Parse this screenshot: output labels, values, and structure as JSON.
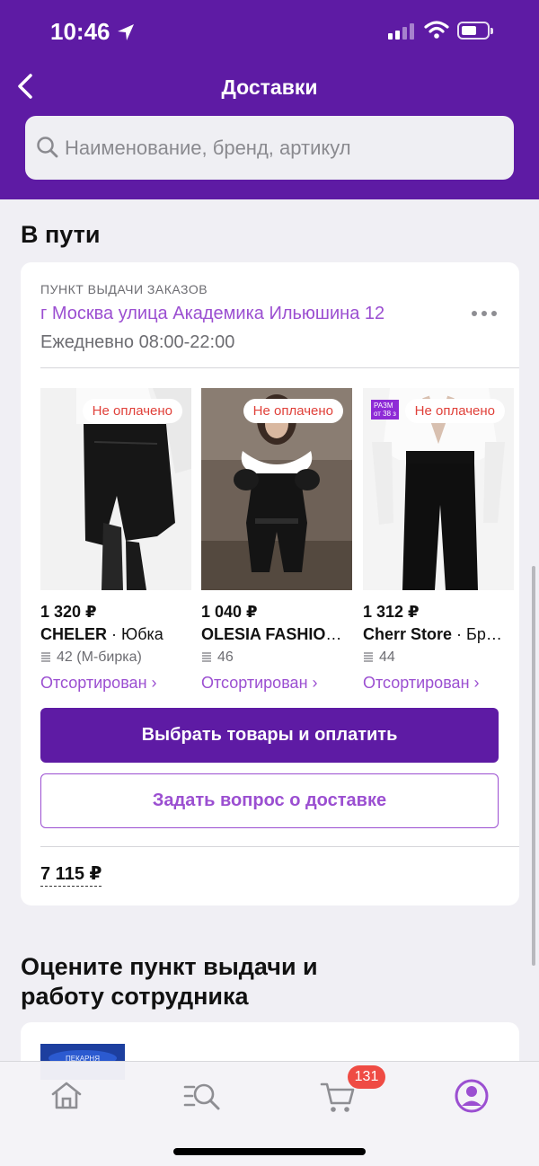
{
  "status_bar": {
    "time": "10:46"
  },
  "nav": {
    "title": "Доставки"
  },
  "search": {
    "placeholder": "Наименование, бренд, артикул"
  },
  "sections": {
    "in_transit": "В пути",
    "rate": "Оцените пункт выдачи и работу сотрудника"
  },
  "delivery": {
    "pickup_label": "ПУНКТ ВЫДАЧИ ЗАКАЗОВ",
    "address": "г Москва  улица Академика Ильюшина 12",
    "hours": "Ежедневно 08:00-22:00",
    "products": [
      {
        "badge": "Не оплачено",
        "price": "1 320 ₽",
        "brand": "CHELER",
        "category": " · Юбка",
        "size": "42 (M-бирка)",
        "status": "Отсортирован ›"
      },
      {
        "badge": "Не оплачено",
        "price": "1 040 ₽",
        "brand": "OLESIA FASHION…",
        "category": "",
        "size": "46",
        "status": "Отсортирован ›"
      },
      {
        "badge": "Не оплачено",
        "price": "1 312 ₽",
        "brand": "Cherr Store",
        "category": " · Бр…",
        "size": "44",
        "status": "Отсортирован ›",
        "size_tag": [
          "РАЗМ",
          "от 38 з"
        ]
      }
    ],
    "pay_button": "Выбрать товары и оплатить",
    "question_button": "Задать вопрос о доставке",
    "total": "7 115 ₽"
  },
  "rate_card": {
    "thumb_text": "ПЕКАРНЯ"
  },
  "tabbar": {
    "items": [
      "home-icon",
      "catalog-search-icon",
      "cart-icon",
      "profile-icon"
    ],
    "cart_count": "131",
    "active_color": "#9b4fd1",
    "inactive_color": "#8e8e93"
  },
  "colors": {
    "brand": "#5e1ba4",
    "accent": "#9b4fd1",
    "alert": "#e0413a"
  }
}
